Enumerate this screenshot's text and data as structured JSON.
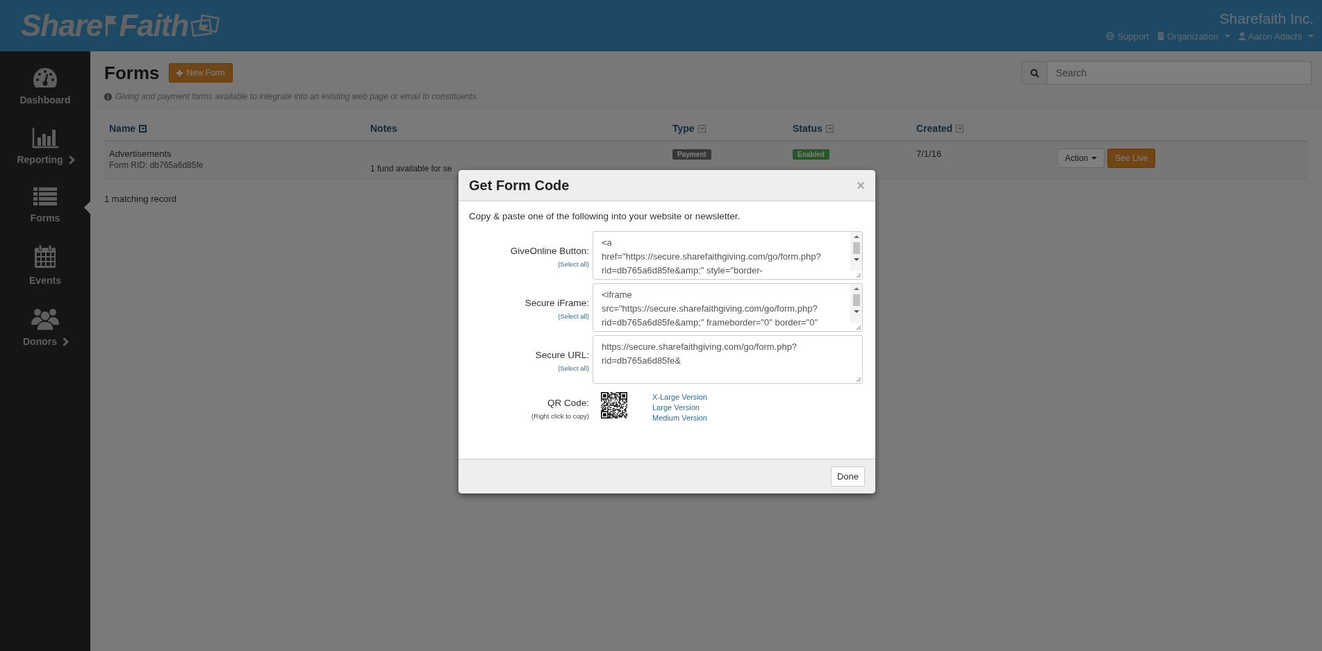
{
  "header": {
    "logo": {
      "left": "Share",
      "right": "Faith"
    },
    "org_name": "Sharefaith Inc.",
    "links": [
      {
        "label": "Support",
        "dropdown": false
      },
      {
        "label": "Organization",
        "dropdown": true
      },
      {
        "label": "Aaron Adachi",
        "dropdown": true
      }
    ]
  },
  "sidebar": {
    "items": [
      {
        "label": "Dashboard",
        "submenu": false,
        "selected": false
      },
      {
        "label": "Reporting",
        "submenu": true,
        "selected": false
      },
      {
        "label": "Forms",
        "submenu": false,
        "selected": true
      },
      {
        "label": "Events",
        "submenu": false,
        "selected": false
      },
      {
        "label": "Donors",
        "submenu": true,
        "selected": false
      }
    ]
  },
  "page": {
    "title": "Forms",
    "new_button": "New Form",
    "search": {
      "placeholder": "Search"
    },
    "info": "Giving and payment forms available to integrate into an existing web page or email to constituents."
  },
  "table": {
    "columns": [
      {
        "label": "Name",
        "sortable": true,
        "sorted": true
      },
      {
        "label": "Notes",
        "sortable": false
      },
      {
        "label": "Type",
        "sortable": true,
        "sorted": false
      },
      {
        "label": "Status",
        "sortable": true,
        "sorted": false
      },
      {
        "label": "Created",
        "sortable": true,
        "sorted": false
      }
    ],
    "rows": [
      {
        "name": "Advertisements",
        "rid": "Form RID: db765a6d85fe",
        "notes": "1 fund available for se",
        "type": "Payment",
        "status": "Enabled",
        "created": "7/1/16",
        "buttons": [
          "Action",
          "See Live"
        ]
      }
    ]
  },
  "footer": "1 matching record",
  "modal": {
    "title": "Get Form Code",
    "close": "×",
    "intro": "Copy & paste one of the following into your website or newsletter.",
    "fields": [
      {
        "kind": "code",
        "label": "GiveOnline Button:",
        "hint": "(Select all)",
        "lines": [
          "<a",
          "href=\"https://secure.sharefaithgiving.com/go/form.php?",
          "rid=db765a6d85fe&amp;\" style=\"border-"
        ],
        "scrollbar": true
      },
      {
        "kind": "code",
        "label": "Secure iFrame:",
        "hint": "(Select all)",
        "lines": [
          "<iframe",
          "src=\"https://secure.sharefaithgiving.com/go/form.php?",
          "rid=db765a6d85fe&amp;\" frameborder=\"0\" border=\"0\""
        ],
        "scrollbar": true
      },
      {
        "kind": "code",
        "label": "Secure URL:",
        "hint": "(Select all)",
        "lines": [
          "https://secure.sharefaithgiving.com/go/form.php?",
          "rid=db765a6d85fe&"
        ],
        "scrollbar": false
      },
      {
        "kind": "qr",
        "label": "QR Code:",
        "hint": "(Right click to copy)",
        "links": [
          "X-Large Version",
          "Large Version",
          "Medium Version"
        ]
      }
    ],
    "done": "Done"
  }
}
